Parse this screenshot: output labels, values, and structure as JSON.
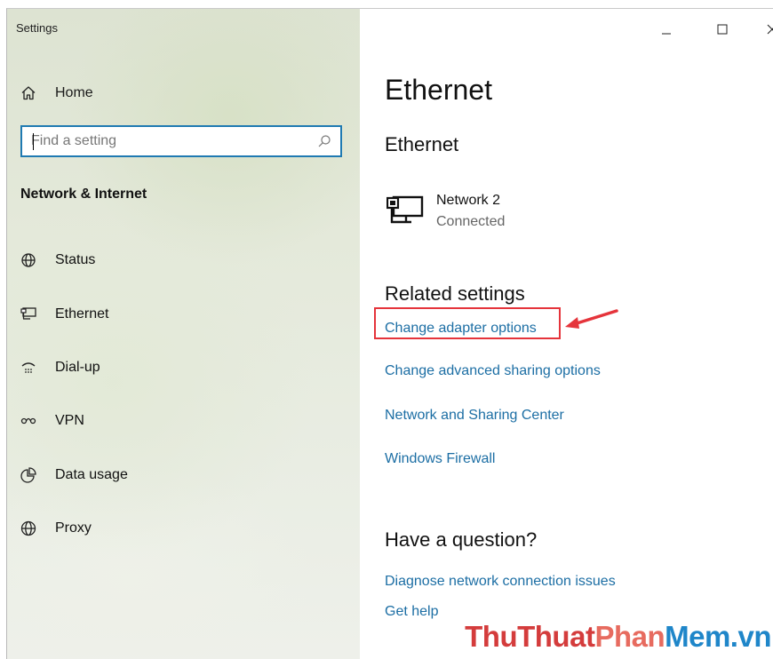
{
  "window": {
    "title": "Settings"
  },
  "sidebar": {
    "home_label": "Home",
    "search": {
      "placeholder": "Find a setting"
    },
    "section_title": "Network & Internet",
    "items": [
      {
        "label": "Status",
        "icon": "status-globe-icon"
      },
      {
        "label": "Ethernet",
        "icon": "ethernet-icon"
      },
      {
        "label": "Dial-up",
        "icon": "dial-up-icon"
      },
      {
        "label": "VPN",
        "icon": "vpn-icon"
      },
      {
        "label": "Data usage",
        "icon": "data-usage-icon"
      },
      {
        "label": "Proxy",
        "icon": "proxy-globe-icon"
      }
    ]
  },
  "main": {
    "page_title": "Ethernet",
    "section_title": "Ethernet",
    "network": {
      "name": "Network 2",
      "status": "Connected"
    },
    "related_title": "Related settings",
    "related_links": [
      "Change adapter options",
      "Change advanced sharing options",
      "Network and Sharing Center",
      "Windows Firewall"
    ],
    "question_title": "Have a question?",
    "help_links": [
      "Diagnose network connection issues",
      "Get help"
    ]
  },
  "watermark": {
    "part1": "ThuThuat",
    "part2": "Phan",
    "part3": "Mem.vn"
  },
  "colors": {
    "link": "#1c6ea4",
    "accent": "#1f7ab2",
    "highlight": "#e5343b"
  }
}
